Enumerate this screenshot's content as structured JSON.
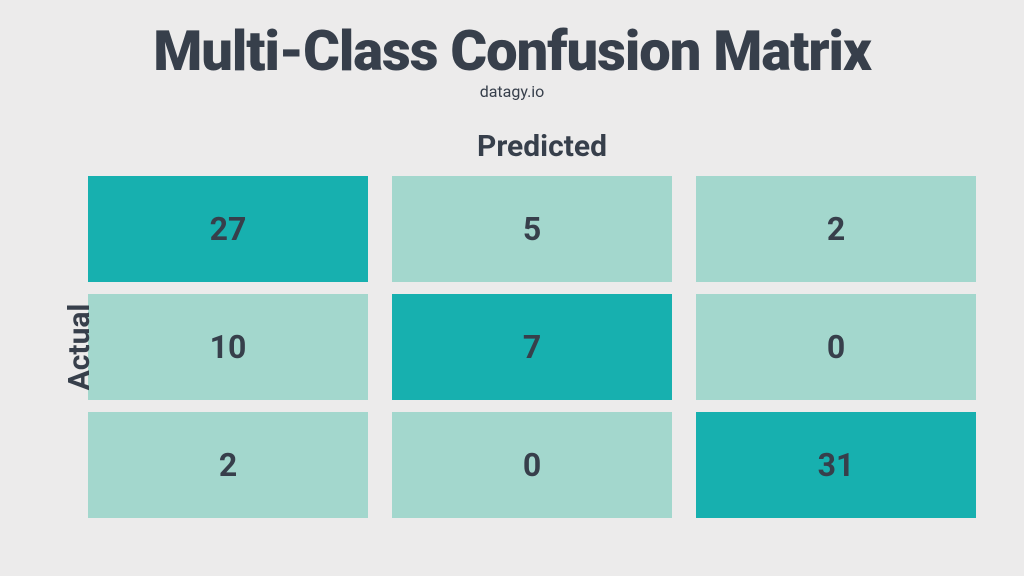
{
  "title": "Multi-Class Confusion Matrix",
  "subtitle": "datagy.io",
  "axes": {
    "predicted": "Predicted",
    "actual": "Actual"
  },
  "colors": {
    "diagonal": "#17b0af",
    "offdiagonal": "#a3d7cd",
    "text": "#373f4b",
    "bg": "#ecebeb"
  },
  "chart_data": {
    "type": "heatmap",
    "title": "Multi-Class Confusion Matrix",
    "xlabel": "Predicted",
    "ylabel": "Actual",
    "rows": 3,
    "cols": 3,
    "values": [
      [
        27,
        5,
        2
      ],
      [
        10,
        7,
        0
      ],
      [
        2,
        0,
        31
      ]
    ]
  }
}
